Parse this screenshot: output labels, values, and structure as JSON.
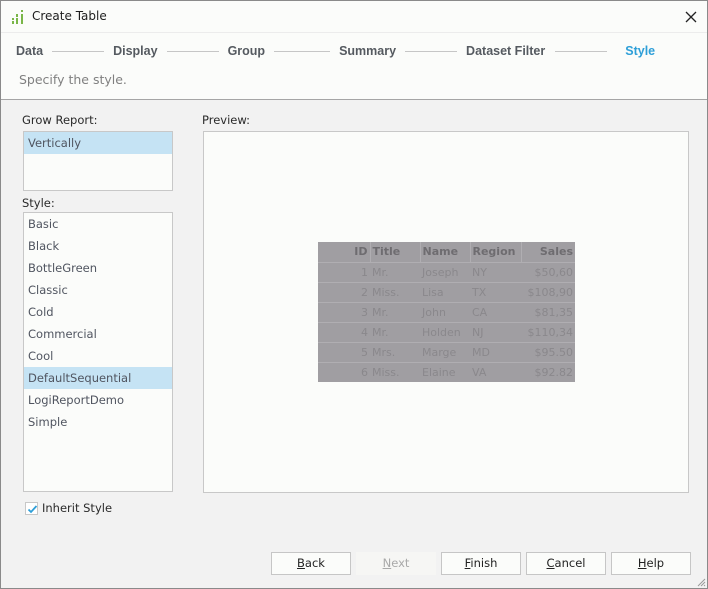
{
  "window": {
    "title": "Create Table",
    "close_icon": "close-icon"
  },
  "wizard": {
    "steps": [
      {
        "label": "Data",
        "active": false
      },
      {
        "label": "Display",
        "active": false
      },
      {
        "label": "Group",
        "active": false
      },
      {
        "label": "Summary",
        "active": false
      },
      {
        "label": "Dataset Filter",
        "active": false
      },
      {
        "label": "Style",
        "active": true
      }
    ],
    "subtitle": "Specify the style.",
    "accent_color": "#2e9fd8"
  },
  "grow_report": {
    "label": "Grow Report:",
    "options": [
      "Vertically"
    ],
    "selected": "Vertically"
  },
  "style": {
    "label": "Style:",
    "options": [
      "Basic",
      "Black",
      "BottleGreen",
      "Classic",
      "Cold",
      "Commercial",
      "Cool",
      "DefaultSequential",
      "LogiReportDemo",
      "Simple"
    ],
    "selected": "DefaultSequential"
  },
  "preview": {
    "label": "Preview:",
    "columns": [
      "ID",
      "Title",
      "Name",
      "Region",
      "Sales"
    ],
    "rows": [
      [
        "1",
        "Mr.",
        "Joseph",
        "NY",
        "$50,60"
      ],
      [
        "2",
        "Miss.",
        "Lisa",
        "TX",
        "$108,90"
      ],
      [
        "3",
        "Mr.",
        "John",
        "CA",
        "$81,35"
      ],
      [
        "4",
        "Mr.",
        "Holden",
        "NJ",
        "$110,34"
      ],
      [
        "5",
        "Mrs.",
        "Marge",
        "MD",
        "$95.50"
      ],
      [
        "6",
        "Miss.",
        "Elaine",
        "VA",
        "$92.82"
      ]
    ]
  },
  "inherit_style": {
    "label": "Inherit Style",
    "checked": true
  },
  "buttons": {
    "back": {
      "mnemonic": "B",
      "rest": "ack"
    },
    "next": {
      "mnemonic": "N",
      "rest": "ext",
      "disabled": true
    },
    "finish": {
      "mnemonic": "F",
      "rest": "inish"
    },
    "cancel": {
      "mnemonic": "C",
      "rest": "ancel"
    },
    "help": {
      "mnemonic": "H",
      "rest": "elp"
    }
  }
}
